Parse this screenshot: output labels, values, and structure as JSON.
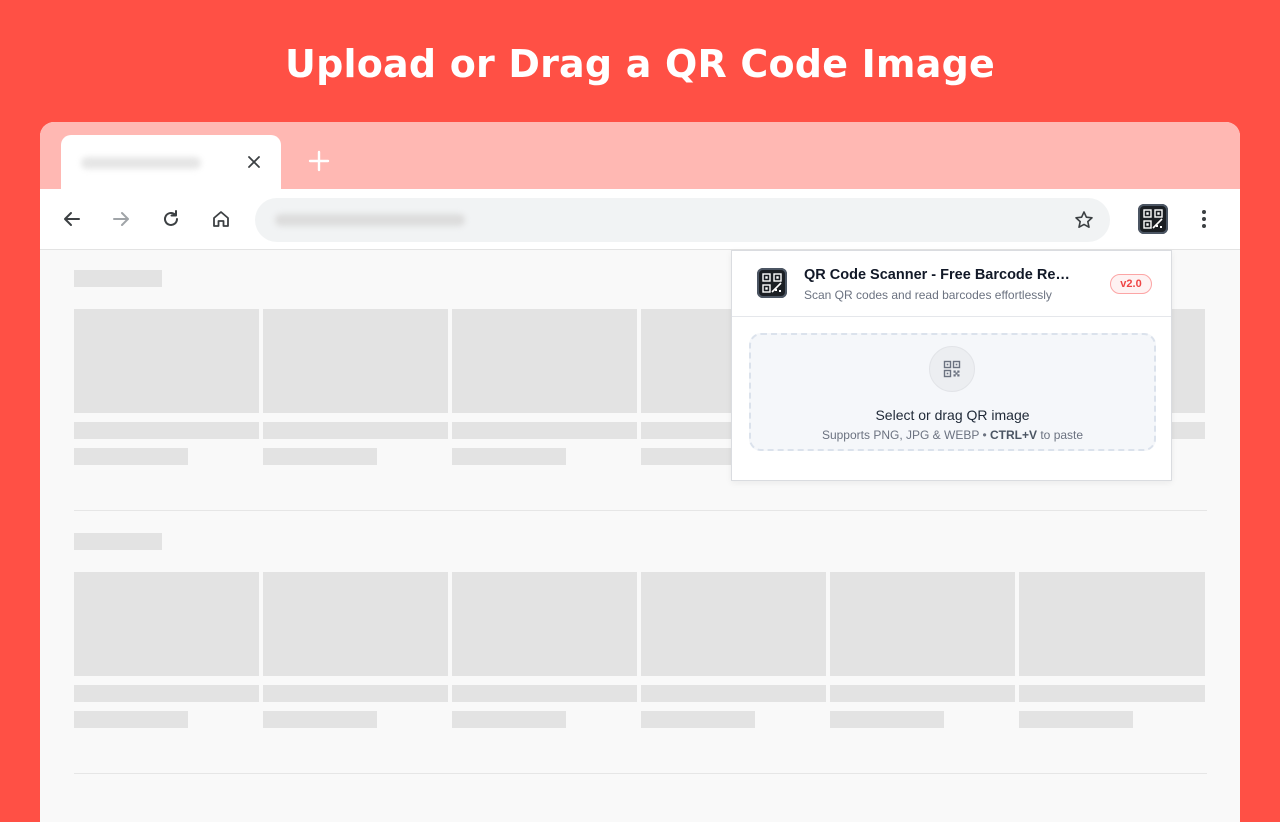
{
  "headline": "Upload or Drag a QR Code Image",
  "colors": {
    "background": "#ff5045",
    "tabstrip": "#ffb8b3",
    "badge_text": "#ef4444",
    "badge_border": "#fca5a5"
  },
  "browser": {
    "tab": {
      "close_icon": "close-icon"
    },
    "new_tab_icon": "plus-icon",
    "toolbar": {
      "back_icon": "arrow-left-icon",
      "forward_icon": "arrow-right-icon",
      "reload_icon": "reload-icon",
      "home_icon": "home-icon",
      "bookmark_icon": "star-icon",
      "extension_icon": "qr-scanner-app-icon",
      "menu_icon": "kebab-menu-icon"
    }
  },
  "popup": {
    "title": "QR Code Scanner - Free Barcode Reader",
    "subtitle": "Scan QR codes and read barcodes effortlessly",
    "version": "v2.0",
    "dropzone": {
      "icon": "qr-code-icon",
      "title": "Select or drag QR image",
      "hint_prefix": "Supports PNG, JPG & WEBP • ",
      "hint_shortcut": "CTRL+V",
      "hint_suffix": " to paste"
    }
  }
}
